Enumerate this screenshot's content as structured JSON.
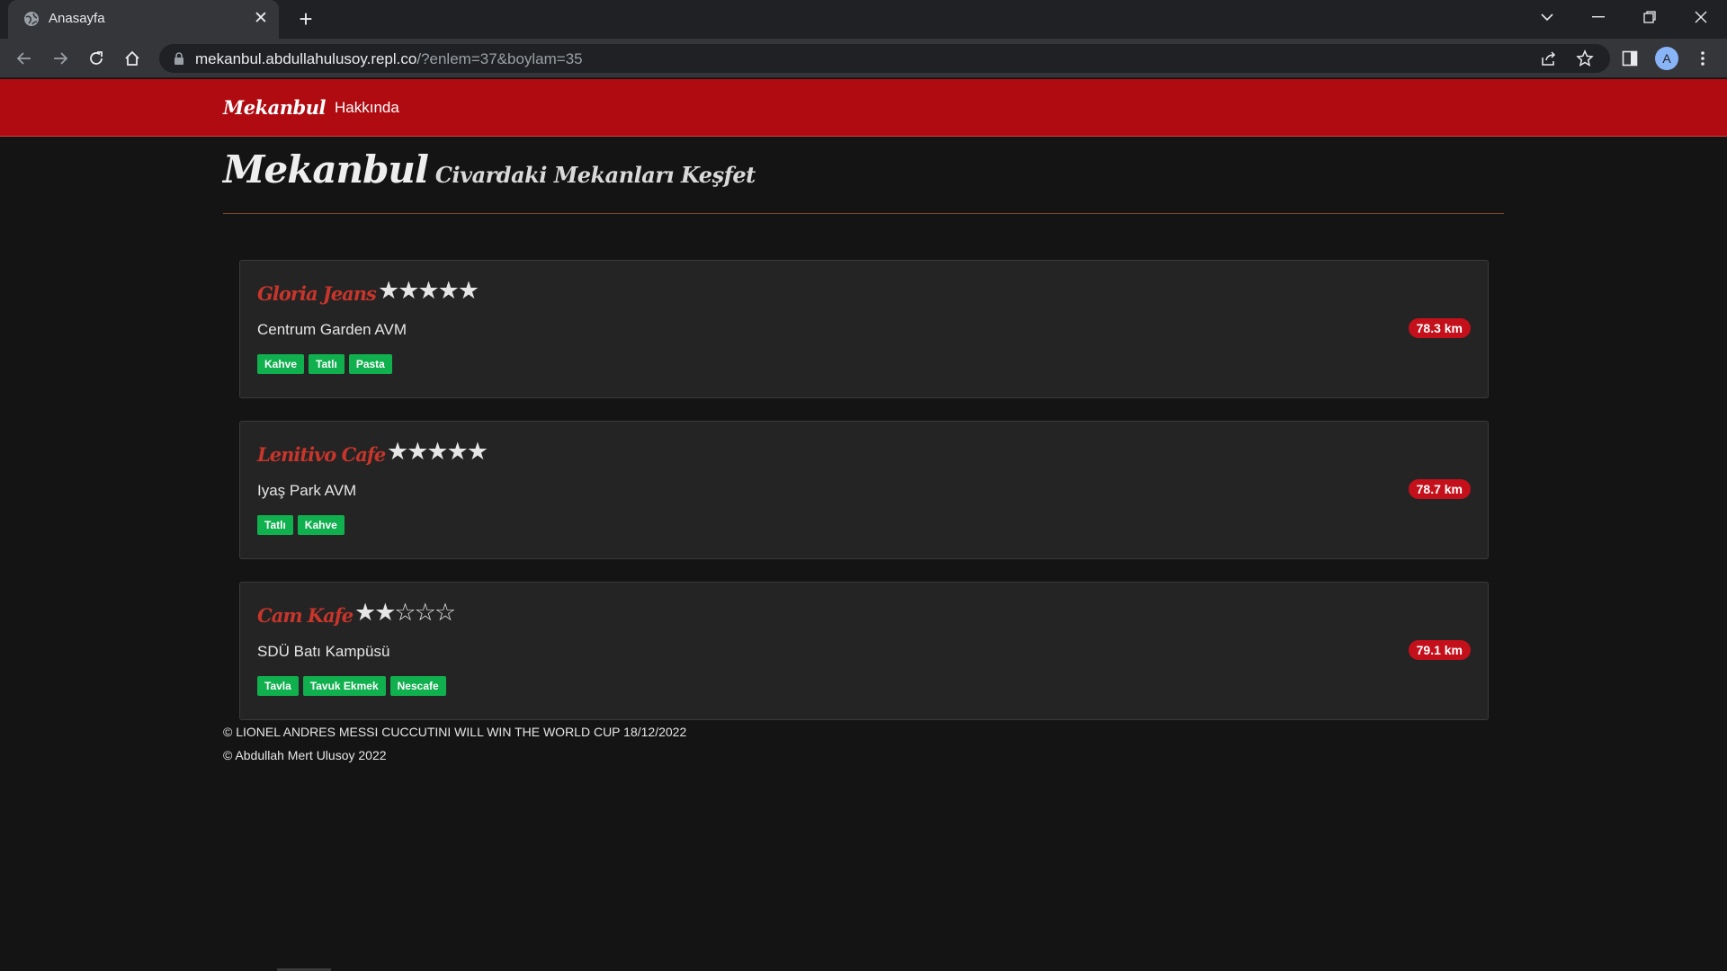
{
  "browser": {
    "tab_title": "Anasayfa",
    "url_host": "mekanbul.abdullahulusoy.repl.co",
    "url_path": "/?enlem=37&boylam=35",
    "profile_initial": "A"
  },
  "navbar": {
    "brand": "Mekanbul",
    "links": [
      {
        "label": "Hakkında"
      }
    ]
  },
  "header": {
    "title": "Mekanbul",
    "subtitle": "Civardaki Mekanları Keşfet"
  },
  "places": [
    {
      "name": "Gloria Jeans",
      "rating": 5,
      "stars": "★★★★★",
      "address": "Centrum Garden AVM",
      "tags": [
        "Kahve",
        "Tatlı",
        "Pasta"
      ],
      "distance": "78.3 km"
    },
    {
      "name": "Lenitivo Cafe",
      "rating": 5,
      "stars": "★★★★★",
      "address": "Iyaş Park AVM",
      "tags": [
        "Tatlı",
        "Kahve"
      ],
      "distance": "78.7 km"
    },
    {
      "name": "Cam Kafe",
      "rating": 2,
      "stars": "★★☆☆☆",
      "address": "SDÜ Batı Kampüsü",
      "tags": [
        "Tavla",
        "Tavuk Ekmek",
        "Nescafe"
      ],
      "distance": "79.1 km"
    }
  ],
  "footer": {
    "line1": "© LIONEL ANDRES MESSI CUCCUTINI WILL WIN THE WORLD CUP 18/12/2022",
    "line2": "© Abdullah Mert Ulusoy 2022"
  },
  "colors": {
    "navbar": "#b00b11",
    "place_name": "#c7352b",
    "tag": "#11b04f",
    "distance_badge": "#c4101b"
  }
}
